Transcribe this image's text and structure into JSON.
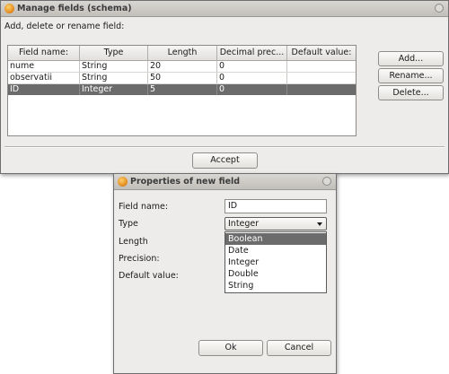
{
  "main_dialog": {
    "title": "Manage fields (schema)",
    "instruction": "Add, delete or rename field:",
    "table": {
      "columns": [
        "Field name:",
        "Type",
        "Length",
        "Decimal prec...",
        "Default value:"
      ],
      "rows": [
        {
          "name": "nume",
          "type": "String",
          "length": "20",
          "decimal": "0",
          "default": ""
        },
        {
          "name": "observatii",
          "type": "String",
          "length": "50",
          "decimal": "0",
          "default": ""
        },
        {
          "name": "ID",
          "type": "Integer",
          "length": "5",
          "decimal": "0",
          "default": "",
          "selected": true
        }
      ]
    },
    "buttons": {
      "add": "Add...",
      "rename": "Rename...",
      "delete": "Delete...",
      "accept": "Accept"
    }
  },
  "props_dialog": {
    "title": "Properties of new field",
    "labels": {
      "field_name": "Field name:",
      "type": "Type",
      "length": "Length",
      "precision": "Precision:",
      "default_value": "Default value:"
    },
    "field_name_value": "ID",
    "type_selected": "Integer",
    "type_options": [
      "Boolean",
      "Date",
      "Integer",
      "Double",
      "String"
    ],
    "highlighted_option": "Boolean",
    "buttons": {
      "ok": "Ok",
      "cancel": "Cancel"
    }
  }
}
